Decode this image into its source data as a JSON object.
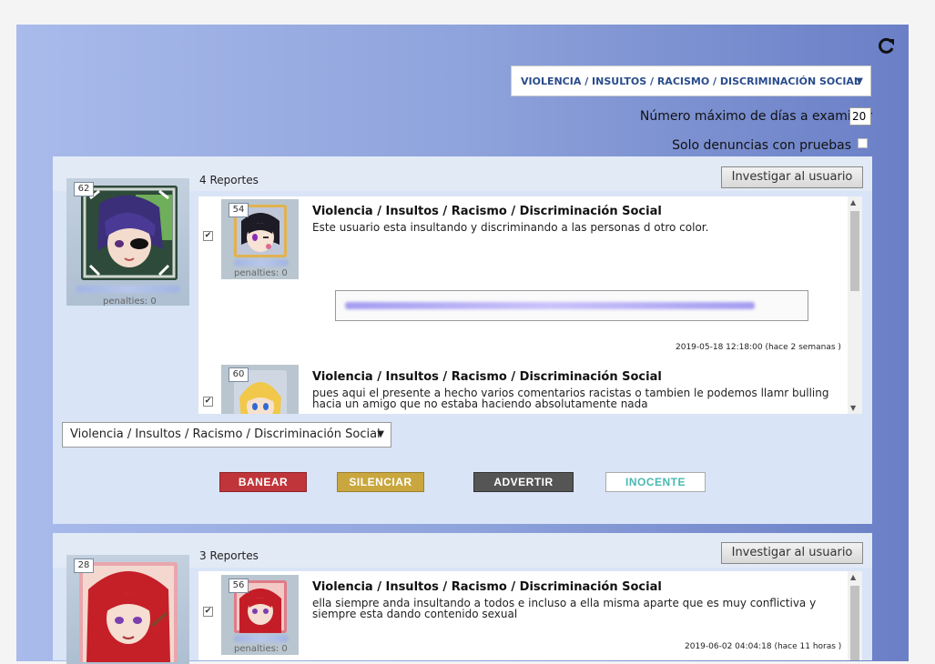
{
  "filters": {
    "category_selected": "VIOLENCIA / INSULTOS / RACISMO / DISCRIMINACIÓN SOCIAL",
    "max_days_label": "Número máximo de días a examinar",
    "max_days_value": "20",
    "proof_only_label": "Solo denuncias con pruebas",
    "proof_only_checked": false
  },
  "users": [
    {
      "level": "62",
      "penalties_label": "penalties: 0",
      "report_count_label": "4 Reportes",
      "investigate_label": "Investigar al usuario",
      "category_select": "Violencia / Insultos / Racismo / Discriminación Social",
      "reports": [
        {
          "reporter_level": "54",
          "reporter_penalties": "penalties: 0",
          "title": "Violencia / Insultos / Racismo / Discriminación Social",
          "text": "Este usuario esta insultando y discriminando a las personas d otro color.",
          "timestamp": "2019-05-18 12:18:00 (hace 2 semanas )",
          "checked": true
        },
        {
          "reporter_level": "60",
          "title": "Violencia / Insultos / Racismo / Discriminación Social",
          "text_line1": "pues aqui el presente a hecho varios comentarios racistas o tambien le podemos llamr bulling",
          "text_line2": "hacia un amigo que no estaba haciendo absolutamente nada",
          "checked": true
        }
      ],
      "actions": {
        "ban": "BANEAR",
        "silence": "SILENCIAR",
        "warn": "ADVERTIR",
        "innocent": "INOCENTE"
      }
    },
    {
      "level": "28",
      "report_count_label": "3 Reportes",
      "investigate_label": "Investigar al usuario",
      "reports": [
        {
          "reporter_level": "56",
          "reporter_penalties": "penalties: 0",
          "title": "Violencia / Insultos / Racismo / Discriminación Social",
          "text_line1": "ella siempre anda insultando a todos e incluso a ella misma aparte que es muy conflictiva y",
          "text_line2": "siempre esta dando contenido sexual",
          "timestamp": "2019-06-02 04:04:18 (hace 11 horas )",
          "checked": true
        }
      ]
    }
  ],
  "colors": {
    "ban": "#c0353a",
    "silence": "#c9a73e",
    "warn": "#555555",
    "innocent_text": "#4ab9b3",
    "accent_text": "#2a4c8c"
  },
  "icons": {
    "refresh": "refresh-icon",
    "dropdown": "chevron-down-icon"
  }
}
